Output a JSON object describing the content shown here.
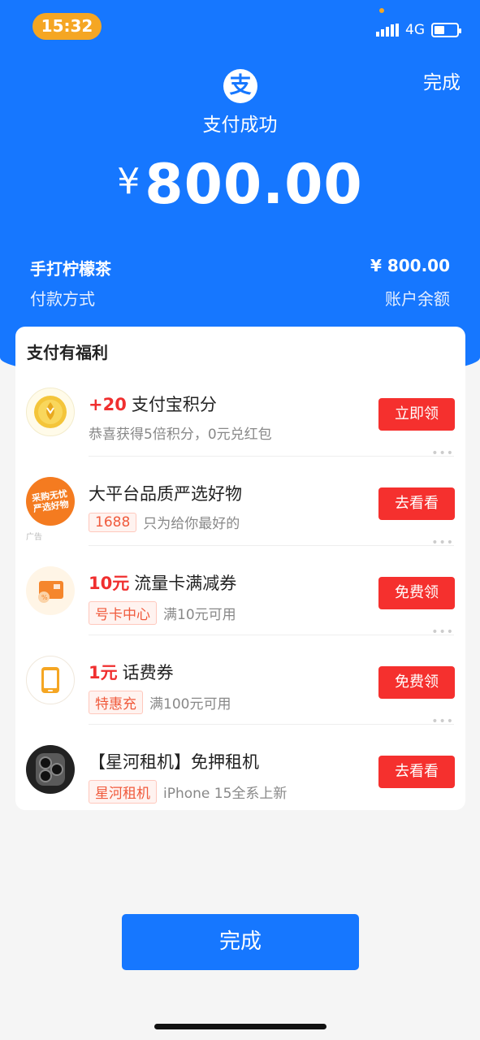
{
  "status_bar": {
    "time": "15:32",
    "network": "4G",
    "battery_level": 0.45
  },
  "header": {
    "done_label": "完成",
    "logo_char": "支",
    "title": "支付成功",
    "currency_symbol": "¥",
    "amount": "800.00"
  },
  "summary": {
    "merchant": "手打柠檬茶",
    "amount": "¥ 800.00",
    "method_label": "付款方式",
    "method_value": "账户余额"
  },
  "benefits": {
    "title": "支付有福利",
    "ad_label": "广告",
    "items": [
      {
        "highlight": "+20",
        "title": "支付宝积分",
        "tag": "",
        "subtitle": "恭喜获得5倍积分，0元兑红包",
        "button": "立即领",
        "icon": "points-coin-icon"
      },
      {
        "highlight": "",
        "title": "大平台品质严选好物",
        "tag": "1688",
        "subtitle": "只为给你最好的",
        "button": "去看看",
        "icon": "1688-logo-icon",
        "logo_text": "采购无忧 严选好物"
      },
      {
        "highlight": "10元",
        "title": "流量卡满减券",
        "tag": "号卡中心",
        "subtitle": "满10元可用",
        "button": "免费领",
        "icon": "sim-card-icon"
      },
      {
        "highlight": "1元",
        "title": "话费券",
        "tag": "特惠充",
        "subtitle": "满100元可用",
        "button": "免费领",
        "icon": "phone-icon"
      },
      {
        "highlight": "",
        "title": "【星河租机】免押租机",
        "tag": "星河租机",
        "subtitle": "iPhone 15全系上新",
        "button": "去看看",
        "icon": "iphone-camera-icon"
      }
    ]
  },
  "footer": {
    "done_label": "完成"
  },
  "colors": {
    "primary": "#1677ff",
    "accent_red": "#f5302e",
    "time_pill": "#f5a623"
  }
}
